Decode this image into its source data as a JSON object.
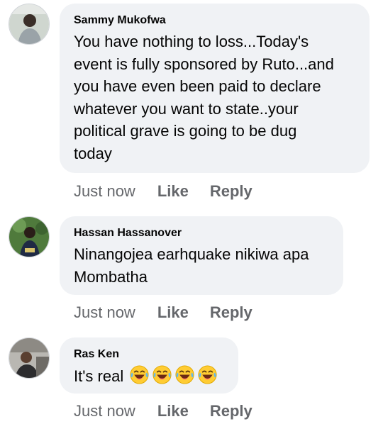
{
  "comments": [
    {
      "author": "Sammy Mukofwa",
      "text": "You have nothing to loss...Today's\nevent is fully sponsored by Ruto...and\nyou have even been paid to declare\nwhatever you want to state..your\npolitical grave is going to be dug\ntoday",
      "time": "Just now",
      "like": "Like",
      "reply": "Reply"
    },
    {
      "author": "Hassan Hassanover",
      "text": "Ninangojea earhquake nikiwa apa\nMombatha",
      "time": "Just now",
      "like": "Like",
      "reply": "Reply"
    },
    {
      "author": "Ras Ken",
      "text": "It's real",
      "emojis": [
        "laughing-tears-emoji",
        "laughing-tears-emoji",
        "laughing-tears-emoji",
        "laughing-tears-emoji"
      ],
      "time": "Just now",
      "like": "Like",
      "reply": "Reply"
    }
  ],
  "colors": {
    "bubble_bg": "#f0f2f5",
    "text": "#050505",
    "secondary": "#65676b"
  }
}
